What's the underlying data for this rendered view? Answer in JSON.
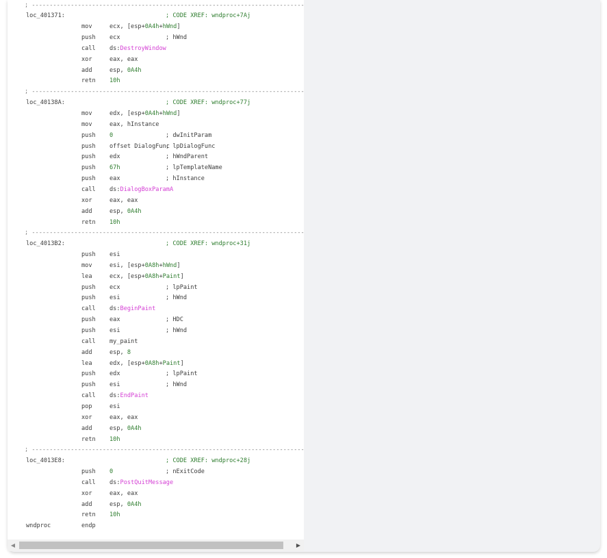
{
  "separator": "; ---------------------------------------------------------------------------------",
  "lines": [
    {
      "type": "sep"
    },
    {
      "type": "label",
      "label": "loc_401371:",
      "comment": "; CODE XREF: wndproc+7Aj"
    },
    {
      "type": "ins",
      "mn": "mov",
      "op": "ecx, [esp+0A4h+hWnd]"
    },
    {
      "type": "ins",
      "mn": "push",
      "op": "ecx",
      "comment": "; hWnd"
    },
    {
      "type": "ins",
      "mn": "call",
      "op": "ds:",
      "api": "DestroyWindow"
    },
    {
      "type": "ins",
      "mn": "xor",
      "op": "eax, eax"
    },
    {
      "type": "ins",
      "mn": "add",
      "op": "esp, 0A4h"
    },
    {
      "type": "ins",
      "mn": "retn",
      "op": "10h"
    },
    {
      "type": "sep"
    },
    {
      "type": "label",
      "label": "loc_40138A:",
      "comment": "; CODE XREF: wndproc+77j"
    },
    {
      "type": "ins",
      "mn": "mov",
      "op": "edx, [esp+0A4h+hWnd]"
    },
    {
      "type": "ins",
      "mn": "mov",
      "op": "eax, hInstance"
    },
    {
      "type": "ins",
      "mn": "push",
      "op": "0",
      "comment": "; dwInitParam"
    },
    {
      "type": "ins",
      "mn": "push",
      "op": "offset DialogFunc",
      "comment": "; lpDialogFunc"
    },
    {
      "type": "ins",
      "mn": "push",
      "op": "edx",
      "comment": "; hWndParent"
    },
    {
      "type": "ins",
      "mn": "push",
      "op": "67h",
      "comment": "; lpTemplateName"
    },
    {
      "type": "ins",
      "mn": "push",
      "op": "eax",
      "comment": "; hInstance"
    },
    {
      "type": "ins",
      "mn": "call",
      "op": "ds:",
      "api": "DialogBoxParamA"
    },
    {
      "type": "ins",
      "mn": "xor",
      "op": "eax, eax"
    },
    {
      "type": "ins",
      "mn": "add",
      "op": "esp, 0A4h"
    },
    {
      "type": "ins",
      "mn": "retn",
      "op": "10h"
    },
    {
      "type": "sep"
    },
    {
      "type": "label",
      "label": "loc_4013B2:",
      "comment": "; CODE XREF: wndproc+31j"
    },
    {
      "type": "ins",
      "mn": "push",
      "op": "esi"
    },
    {
      "type": "ins",
      "mn": "mov",
      "op": "esi, [esp+0A8h+hWnd]"
    },
    {
      "type": "ins",
      "mn": "lea",
      "op": "ecx, [esp+0A8h+Paint]"
    },
    {
      "type": "ins",
      "mn": "push",
      "op": "ecx",
      "comment": "; lpPaint"
    },
    {
      "type": "ins",
      "mn": "push",
      "op": "esi",
      "comment": "; hWnd"
    },
    {
      "type": "ins",
      "mn": "call",
      "op": "ds:",
      "api": "BeginPaint"
    },
    {
      "type": "ins",
      "mn": "push",
      "op": "eax",
      "comment": "; HDC"
    },
    {
      "type": "ins",
      "mn": "push",
      "op": "esi",
      "comment": "; hWnd"
    },
    {
      "type": "ins",
      "mn": "call",
      "op": "my_paint"
    },
    {
      "type": "ins",
      "mn": "add",
      "op": "esp, 8"
    },
    {
      "type": "ins",
      "mn": "lea",
      "op": "edx, [esp+0A8h+Paint]"
    },
    {
      "type": "ins",
      "mn": "push",
      "op": "edx",
      "comment": "; lpPaint"
    },
    {
      "type": "ins",
      "mn": "push",
      "op": "esi",
      "comment": "; hWnd"
    },
    {
      "type": "ins",
      "mn": "call",
      "op": "ds:",
      "api": "EndPaint"
    },
    {
      "type": "ins",
      "mn": "pop",
      "op": "esi"
    },
    {
      "type": "ins",
      "mn": "xor",
      "op": "eax, eax"
    },
    {
      "type": "ins",
      "mn": "add",
      "op": "esp, 0A4h"
    },
    {
      "type": "ins",
      "mn": "retn",
      "op": "10h"
    },
    {
      "type": "sep"
    },
    {
      "type": "label",
      "label": "loc_4013E8:",
      "comment": "; CODE XREF: wndproc+28j"
    },
    {
      "type": "ins",
      "mn": "push",
      "op": "0",
      "comment": "; nExitCode"
    },
    {
      "type": "ins",
      "mn": "call",
      "op": "ds:",
      "api": "PostQuitMessage"
    },
    {
      "type": "ins",
      "mn": "xor",
      "op": "eax, eax"
    },
    {
      "type": "ins",
      "mn": "add",
      "op": "esp, 0A4h"
    },
    {
      "type": "ins",
      "mn": "retn",
      "op": "10h"
    },
    {
      "type": "endp",
      "label": "wndproc",
      "mn": "endp"
    }
  ],
  "scrollbar": {
    "left_arrow_icon": "triangle-left-icon",
    "right_arrow_icon": "triangle-right-icon",
    "left_glyph": "◀",
    "right_glyph": "▶"
  },
  "colors": {
    "api": "#d43fd4",
    "number": "#2f7d2f",
    "xref": "#2f7d2f"
  }
}
